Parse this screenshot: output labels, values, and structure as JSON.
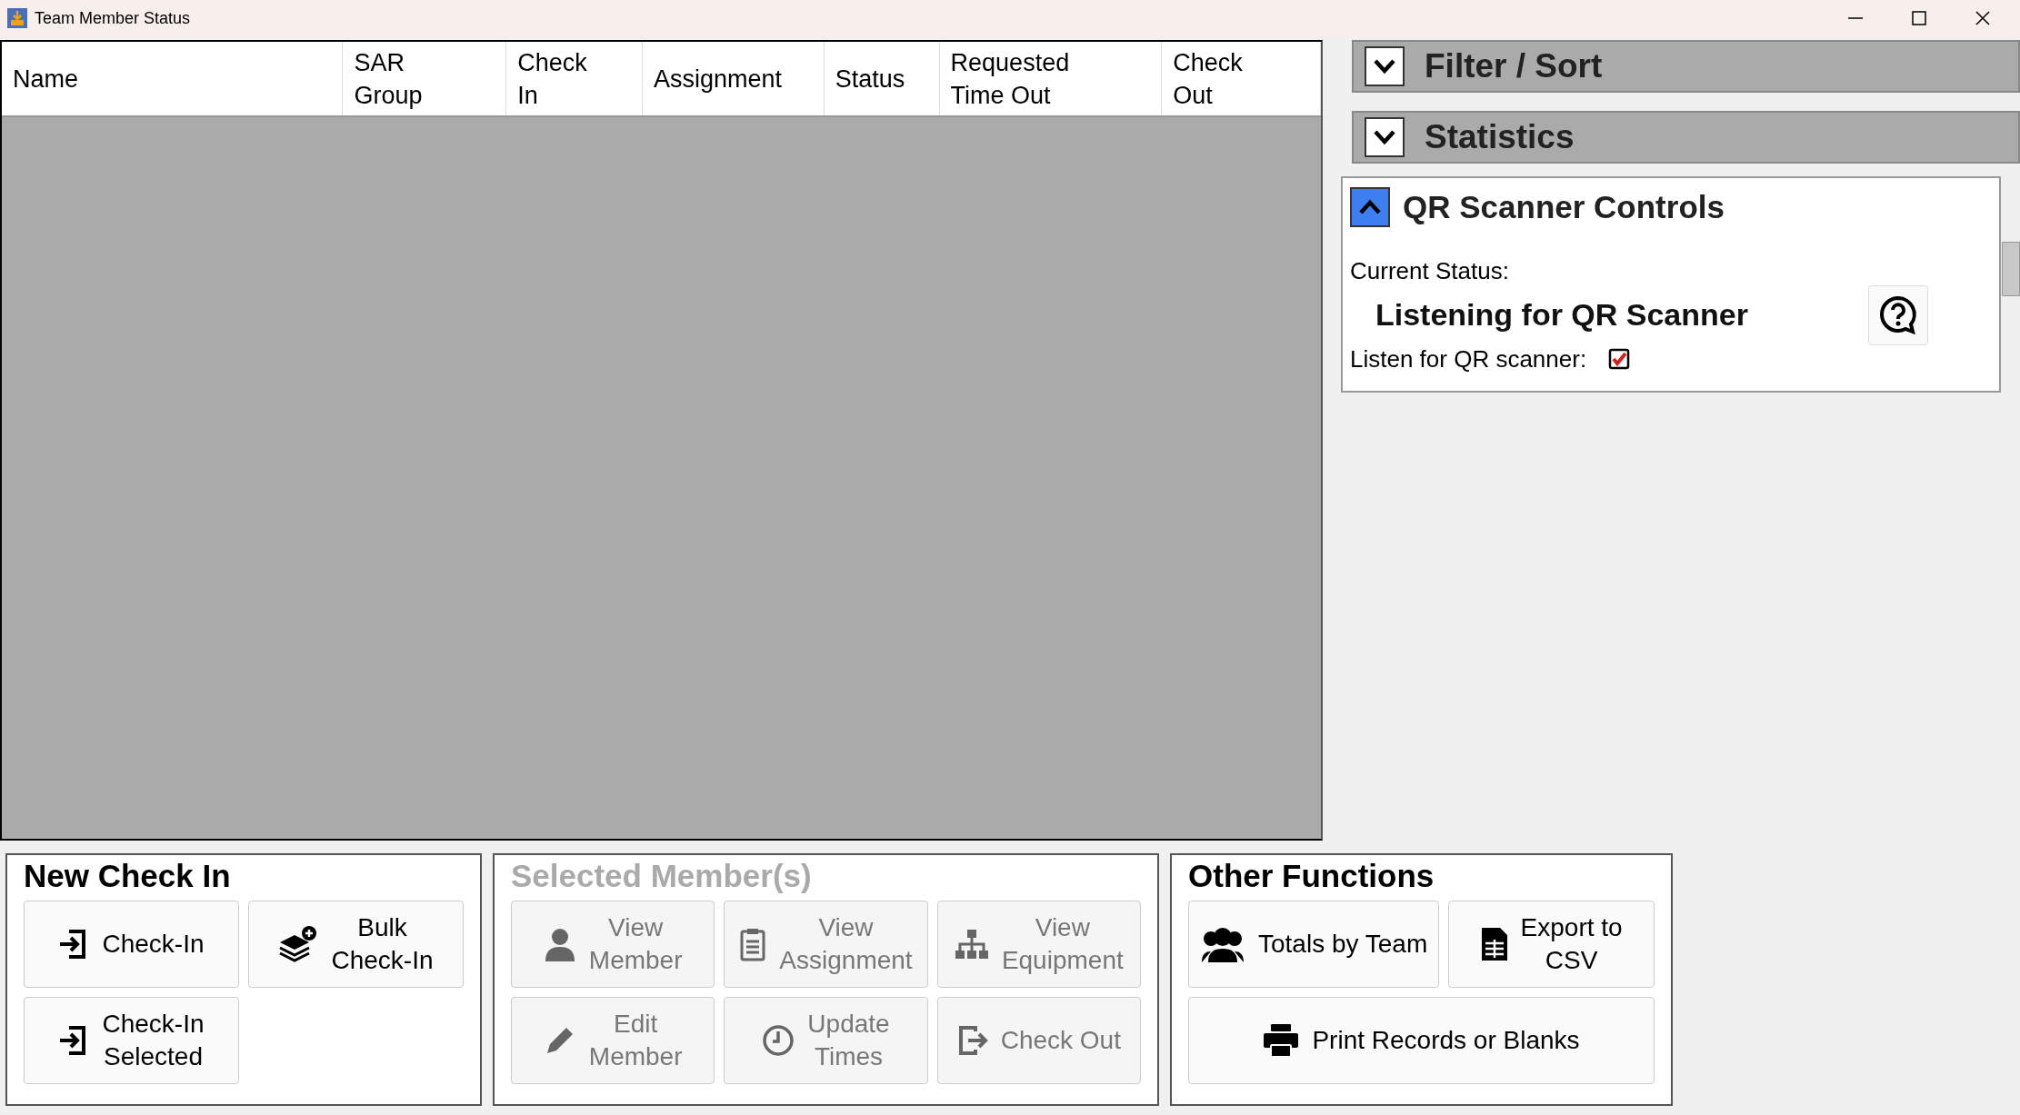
{
  "window": {
    "title": "Team Member Status"
  },
  "table": {
    "columns": [
      "Name",
      "SAR\nGroup",
      "Check\nIn",
      "Assignment",
      "Status",
      "Requested\nTime Out",
      "Check\nOut"
    ]
  },
  "side_panels": [
    {
      "title": "Filter / Sort",
      "expanded": false
    },
    {
      "title": "Statistics",
      "expanded": false
    },
    {
      "title": "QR Scanner Controls",
      "expanded": true,
      "status_label": "Current Status:",
      "status_value": "Listening for QR Scanner",
      "listen_label": "Listen for QR scanner:",
      "listen_checked": true
    }
  ],
  "groups": [
    {
      "title": "New Check In",
      "disabled": false,
      "buttons": [
        {
          "label": "Check-In",
          "wide": false
        },
        {
          "label": "Bulk\nCheck-In",
          "wide": false
        },
        {
          "label": "Check-In\nSelected",
          "wide": false
        }
      ]
    },
    {
      "title": "Selected Member(s)",
      "disabled": true,
      "buttons": [
        {
          "label": "View\nMember",
          "wide": false
        },
        {
          "label": "View\nAssignment",
          "wide": false
        },
        {
          "label": "View\nEquipment",
          "wide": false
        },
        {
          "label": "Edit\nMember",
          "wide": false
        },
        {
          "label": "Update\nTimes",
          "wide": false
        },
        {
          "label": "Check Out",
          "wide": false
        }
      ]
    },
    {
      "title": "Other Functions",
      "disabled": false,
      "buttons": [
        {
          "label": "Totals by Team",
          "wide": false
        },
        {
          "label": "Export to\nCSV",
          "wide": false
        },
        {
          "label": "Print Records or Blanks",
          "wide": true
        }
      ]
    }
  ]
}
